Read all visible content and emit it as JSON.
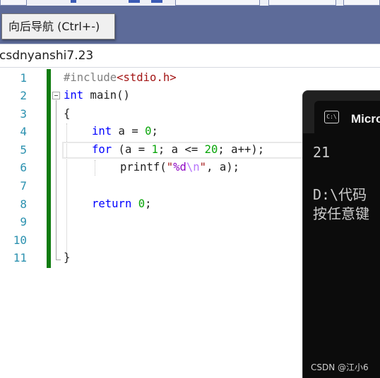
{
  "tooltip": {
    "text": "向后导航 (Ctrl+-)"
  },
  "file": {
    "title": "csdnyanshi7.23"
  },
  "editor": {
    "line_numbers": [
      "1",
      "2",
      "3",
      "4",
      "5",
      "6",
      "7",
      "8",
      "9",
      "10",
      "11"
    ],
    "code": {
      "l1_directive": "#include",
      "l1_header": "<stdio.h>",
      "l2_kw": "int",
      "l2_rest": " main()",
      "l3": "{",
      "l4_kw": "int",
      "l4_a": " a = ",
      "l4_num": "0",
      "l4_end": ";",
      "l5_kw": "for",
      "l5_a": " (a = ",
      "l5_num1": "1",
      "l5_b": "; a <= ",
      "l5_num2": "20",
      "l5_c": "; a++);",
      "l6_fn": "printf(",
      "l6_q1": "\"",
      "l6_fmt": "%d",
      "l6_esc": "\\n",
      "l6_q2": "\"",
      "l6_rest": ", a);",
      "l8_kw": "return",
      "l8_sp": " ",
      "l8_num": "0",
      "l8_end": ";",
      "l11": "}"
    }
  },
  "console": {
    "tab_title": "Microsoft Visual Studio 调试控制台",
    "tab_icon": "C:\\",
    "output_line1": "21",
    "output_line2": "D:\\代码",
    "output_line3": "按任意键",
    "watermark": "CSDN @江小6"
  }
}
